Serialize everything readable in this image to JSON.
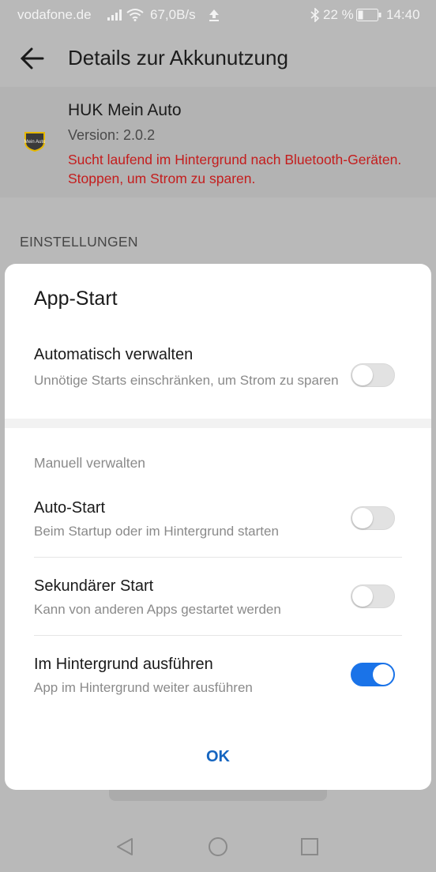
{
  "status_bar": {
    "carrier": "vodafone.de",
    "speed": "67,0B/s",
    "battery": "22 %",
    "time": "14:40"
  },
  "header": {
    "title": "Details zur Akkunutzung"
  },
  "app": {
    "name": "HUK Mein Auto",
    "version": "Version: 2.0.2",
    "warning": "Sucht laufend im Hintergrund nach Bluetooth-Geräten. Stoppen, um Strom zu sparen.",
    "icon_text": "Mein Auto"
  },
  "settings": {
    "section_label": "EINSTELLUNGEN"
  },
  "dialog": {
    "title": "App-Start",
    "auto_manage": {
      "title": "Automatisch verwalten",
      "subtitle": "Unnötige Starts einschränken, um Strom zu sparen",
      "enabled": false
    },
    "manual_label": "Manuell verwalten",
    "auto_start": {
      "title": "Auto-Start",
      "subtitle": "Beim Startup oder im Hintergrund starten",
      "enabled": false
    },
    "secondary_start": {
      "title": "Sekundärer Start",
      "subtitle": "Kann von anderen Apps gestartet werden",
      "enabled": false
    },
    "background_run": {
      "title": "Im Hintergrund ausführen",
      "subtitle": "App im Hintergrund weiter ausführen",
      "enabled": true
    },
    "ok_label": "OK"
  },
  "colors": {
    "accent": "#1a73e8",
    "warning": "#c41d1d",
    "ok_text": "#1565c0"
  }
}
